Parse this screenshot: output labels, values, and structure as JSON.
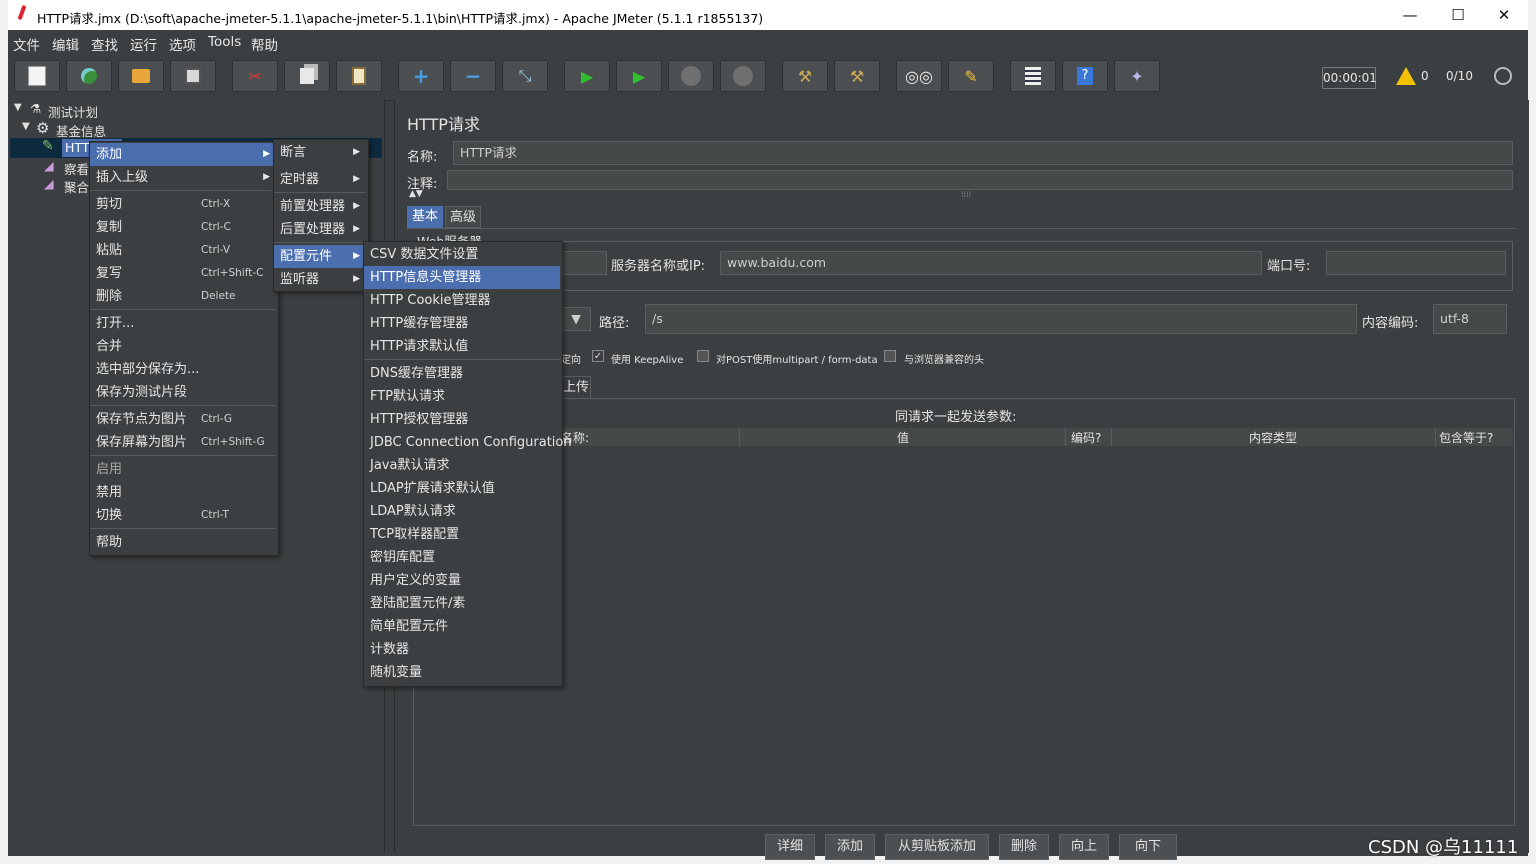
{
  "window": {
    "title": "HTTP请求.jmx (D:\\soft\\apache-jmeter-5.1.1\\apache-jmeter-5.1.1\\bin\\HTTP请求.jmx) - Apache JMeter (5.1.1 r1855137)",
    "minimize": "—",
    "maximize": "☐",
    "close": "✕"
  },
  "menubar": [
    "文件",
    "编辑",
    "查找",
    "运行",
    "选项",
    "Tools",
    "帮助"
  ],
  "toolbar": {
    "timer": "00:00:01",
    "warn_count": "0",
    "threads": "0/10",
    "icons": [
      "new-icon",
      "template-icon",
      "open-icon",
      "save-icon",
      "cut-icon",
      "copy-icon",
      "paste-icon",
      "expand-icon",
      "collapse-icon",
      "toggle-icon",
      "start-icon",
      "start-no-pause-icon",
      "stop-icon",
      "shutdown-icon",
      "clear-icon",
      "clear-all-icon",
      "search-icon",
      "reset-search-icon",
      "function-helper-icon",
      "help-icon",
      "remote-icon"
    ]
  },
  "tree": {
    "plan": "测试计划",
    "group": "基金信息",
    "http": "HTTP",
    "child1": "察看",
    "child2": "聚合"
  },
  "context_menu": {
    "items": [
      {
        "label": "添加",
        "key": "",
        "submenu": true,
        "selected": true
      },
      {
        "label": "插入上级",
        "key": "",
        "submenu": true
      },
      {
        "label": "剪切",
        "key": "Ctrl-X"
      },
      {
        "label": "复制",
        "key": "Ctrl-C"
      },
      {
        "label": "粘贴",
        "key": "Ctrl-V"
      },
      {
        "label": "复写",
        "key": "Ctrl+Shift-C"
      },
      {
        "label": "删除",
        "key": "Delete"
      },
      {
        "label": "打开...",
        "key": ""
      },
      {
        "label": "合并",
        "key": ""
      },
      {
        "label": "选中部分保存为...",
        "key": ""
      },
      {
        "label": "保存为测试片段",
        "key": ""
      },
      {
        "label": "保存节点为图片",
        "key": "Ctrl-G"
      },
      {
        "label": "保存屏幕为图片",
        "key": "Ctrl+Shift-G"
      },
      {
        "label": "启用",
        "key": "",
        "disabled": true
      },
      {
        "label": "禁用",
        "key": ""
      },
      {
        "label": "切换",
        "key": "Ctrl-T"
      },
      {
        "label": "帮助",
        "key": ""
      }
    ]
  },
  "add_menu": {
    "items": [
      {
        "label": "断言"
      },
      {
        "label": "定时器"
      },
      {
        "label": "前置处理器"
      },
      {
        "label": "后置处理器"
      },
      {
        "label": "配置元件",
        "selected": true
      },
      {
        "label": "监听器"
      }
    ]
  },
  "config_menu": {
    "items": [
      {
        "label": "CSV 数据文件设置"
      },
      {
        "label": "HTTP信息头管理器",
        "selected": true
      },
      {
        "label": "HTTP Cookie管理器"
      },
      {
        "label": "HTTP缓存管理器"
      },
      {
        "label": "HTTP请求默认值"
      },
      {
        "label": "DNS缓存管理器"
      },
      {
        "label": "FTP默认请求"
      },
      {
        "label": "HTTP授权管理器"
      },
      {
        "label": "JDBC Connection Configuration"
      },
      {
        "label": "Java默认请求"
      },
      {
        "label": "LDAP扩展请求默认值"
      },
      {
        "label": "LDAP默认请求"
      },
      {
        "label": "TCP取样器配置"
      },
      {
        "label": "密钥库配置"
      },
      {
        "label": "用户定义的变量"
      },
      {
        "label": "登陆配置元件/素"
      },
      {
        "label": "简单配置元件"
      },
      {
        "label": "计数器"
      },
      {
        "label": "随机变量"
      }
    ]
  },
  "panel": {
    "title": "HTTP请求",
    "name_label": "名称:",
    "name_value": "HTTP请求",
    "comment_label": "注释:",
    "tab_basic": "基本",
    "tab_advanced": "高级",
    "web_server": "Web服务器",
    "server_label": "服务器名称或IP:",
    "server_value": "www.baidu.com",
    "port_label": "端口号:",
    "path_label": "路径:",
    "path_value": "/s",
    "encoding_label": "内容编码:",
    "encoding_value": "utf-8",
    "redirect_tail": "定向",
    "keepalive": "使用 KeepAlive",
    "multipart": "对POST使用multipart / form-data",
    "browser_headers": "与浏览器兼容的头",
    "upload_tab": "上传",
    "params_title": "同请求一起发送参数:",
    "columns": [
      "名称:",
      "值",
      "编码?",
      "内容类型",
      "包含等于?"
    ],
    "buttons": [
      "详细",
      "添加",
      "从剪贴板添加",
      "删除",
      "向上",
      "向下"
    ]
  },
  "watermark": "CSDN @乌11111"
}
